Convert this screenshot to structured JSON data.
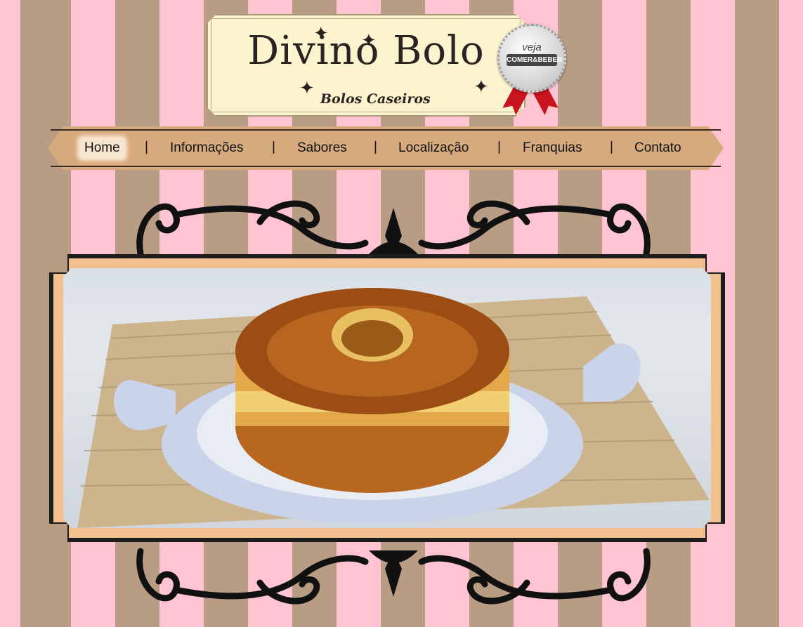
{
  "brand": {
    "title": "Divino Bolo",
    "subtitle": "Bolos Caseiros",
    "badge_top": "veja",
    "badge_main": "COMER&BEBER"
  },
  "nav": {
    "items": [
      "Home",
      "Informações",
      "Sabores",
      "Localização",
      "Franquias",
      "Contato"
    ],
    "separator": "|",
    "active": "Home"
  },
  "colors": {
    "stripe_pink": "#ffc4d1",
    "stripe_brown": "#b99c84",
    "nav_bg": "#d6aa7c",
    "frame_peach": "#f2c08e",
    "logo_bg": "#fbf4cf"
  },
  "images": {
    "hero": "bundt-cake-photo",
    "ornament": "black-scroll-ornament"
  }
}
